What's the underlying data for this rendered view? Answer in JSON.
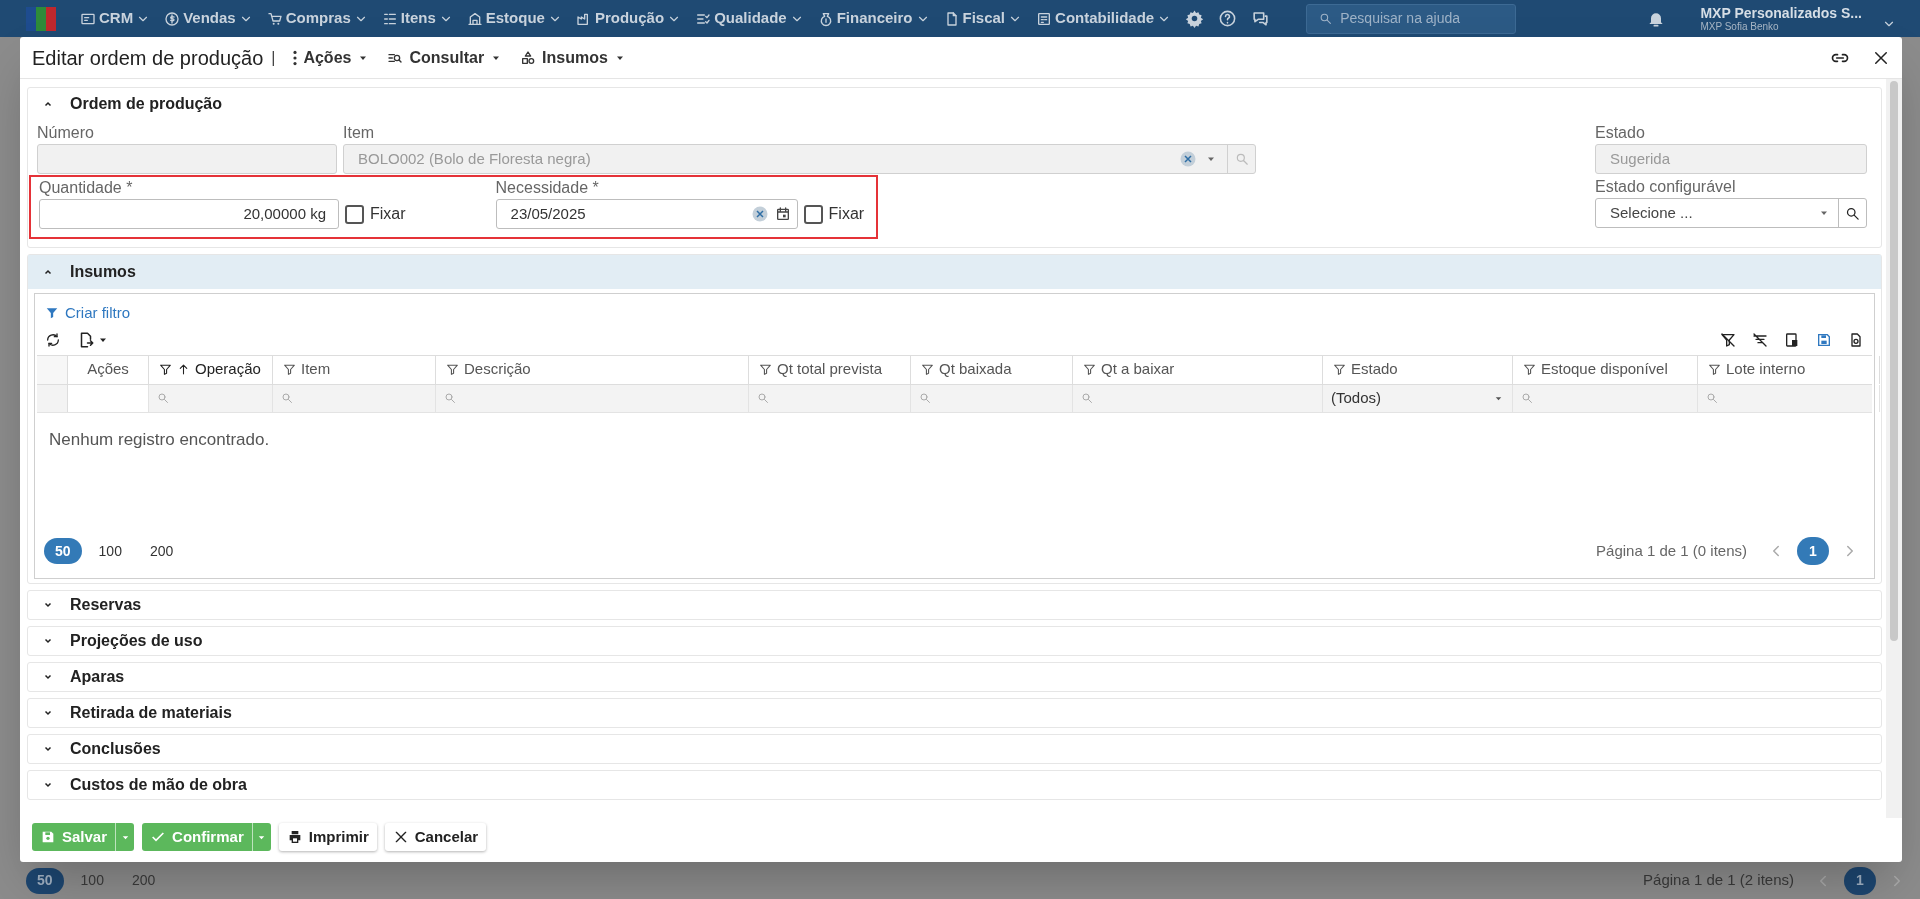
{
  "nav": {
    "menus": [
      {
        "label": "CRM"
      },
      {
        "label": "Vendas"
      },
      {
        "label": "Compras"
      },
      {
        "label": "Itens"
      },
      {
        "label": "Estoque"
      },
      {
        "label": "Produção"
      },
      {
        "label": "Qualidade"
      },
      {
        "label": "Financeiro"
      },
      {
        "label": "Fiscal"
      },
      {
        "label": "Contabilidade"
      }
    ],
    "search": {
      "placeholder": "Pesquisar na ajuda"
    },
    "company": "MXP Personalizados S...",
    "user": "MXP Sofia Benko"
  },
  "background_pager": {
    "sizes": [
      {
        "label": "50",
        "selected": true
      },
      {
        "label": "100",
        "selected": false
      },
      {
        "label": "200",
        "selected": false
      }
    ],
    "summary": "Página 1 de 1 (2 itens)",
    "pages": [
      {
        "label": "1",
        "selected": true
      }
    ]
  },
  "dialog": {
    "title": "Editar ordem de produção",
    "separator": "|",
    "toolbar": [
      {
        "label": "Ações"
      },
      {
        "label": "Consultar"
      },
      {
        "label": "Insumos"
      }
    ],
    "order_section": {
      "title": "Ordem de produção",
      "expanded": true,
      "numero": {
        "label": "Número",
        "disabled": true
      },
      "item": {
        "label": "Item",
        "value": "BOLO002 (Bolo de Floresta negra)",
        "disabled": true
      },
      "estado": {
        "label": "Estado",
        "value": "Sugerida",
        "disabled": true
      },
      "required_row": {
        "highlighted": true,
        "quantidade": {
          "label": "Quantidade *",
          "value": "20,00000 kg",
          "fix": {
            "label": "Fixar",
            "checked": false
          }
        },
        "necessidade": {
          "label": "Necessidade *",
          "value": "23/05/2025",
          "fix": {
            "label": "Fixar",
            "checked": false
          }
        }
      },
      "estado_configuravel": {
        "label": "Estado configurável",
        "placeholder": "Selecione ..."
      }
    },
    "insumos_section": {
      "title": "Insumos",
      "expanded": true,
      "filter_link": "Criar filtro",
      "columns": [
        {
          "label": "Ações",
          "filterable": false,
          "sorted": false,
          "filter": {
            "kind": "none"
          }
        },
        {
          "label": "Operação",
          "filterable": true,
          "sorted": true,
          "filter": {
            "kind": "search"
          }
        },
        {
          "label": "Item",
          "filterable": true,
          "sorted": false,
          "filter": {
            "kind": "search"
          }
        },
        {
          "label": "Descrição",
          "filterable": true,
          "sorted": false,
          "filter": {
            "kind": "search"
          }
        },
        {
          "label": "Qt total prevista",
          "filterable": true,
          "sorted": false,
          "filter": {
            "kind": "search"
          }
        },
        {
          "label": "Qt baixada",
          "filterable": true,
          "sorted": false,
          "filter": {
            "kind": "search"
          }
        },
        {
          "label": "Qt a baixar",
          "filterable": true,
          "sorted": false,
          "filter": {
            "kind": "search"
          }
        },
        {
          "label": "Estado",
          "filterable": true,
          "sorted": false,
          "filter": {
            "kind": "select",
            "value": "(Todos)"
          }
        },
        {
          "label": "Estoque disponível",
          "filterable": true,
          "sorted": false,
          "filter": {
            "kind": "search"
          }
        },
        {
          "label": "Lote interno",
          "filterable": true,
          "sorted": false,
          "filter": {
            "kind": "search"
          }
        }
      ],
      "empty_message": "Nenhum registro encontrado.",
      "pager": {
        "sizes": [
          {
            "label": "50",
            "selected": true
          },
          {
            "label": "100",
            "selected": false
          },
          {
            "label": "200",
            "selected": false
          }
        ],
        "summary": "Página 1 de 1 (0 itens)",
        "pages": [
          {
            "label": "1",
            "selected": true
          }
        ]
      }
    },
    "sections": [
      {
        "title": "Reservas",
        "expanded": false
      },
      {
        "title": "Projeções de uso",
        "expanded": false
      },
      {
        "title": "Aparas",
        "expanded": false
      },
      {
        "title": "Retirada de materiais",
        "expanded": false
      },
      {
        "title": "Conclusões",
        "expanded": false
      },
      {
        "title": "Custos de mão de obra",
        "expanded": false
      }
    ],
    "buttons": [
      {
        "label": "Salvar",
        "kind": "split"
      },
      {
        "label": "Confirmar",
        "kind": "split"
      },
      {
        "label": "Imprimir",
        "kind": "plain"
      },
      {
        "label": "Cancelar",
        "kind": "plain"
      }
    ]
  }
}
